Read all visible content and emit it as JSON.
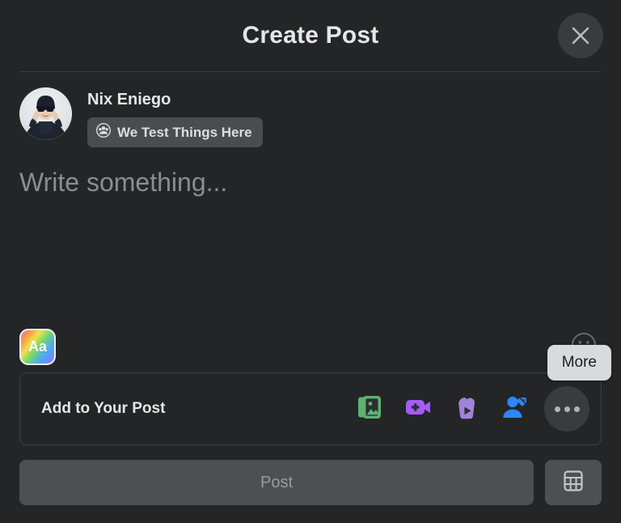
{
  "header": {
    "title": "Create Post",
    "close_icon": "close-icon"
  },
  "author": {
    "name": "Nix Eniego",
    "avatar_icon": "avatar-photo",
    "audience": {
      "label": "We Test Things Here",
      "icon": "friends-group-icon"
    }
  },
  "composer": {
    "placeholder": "Write something...",
    "value": "",
    "background_button": {
      "label": "Aa",
      "icon": "text-background-icon"
    },
    "emoji_button": {
      "icon": "smiley-face-icon"
    }
  },
  "add_section": {
    "label": "Add to Your Post",
    "actions": [
      {
        "name": "photo-video",
        "icon": "photo-video-icon",
        "color": "#5db274"
      },
      {
        "name": "live-video",
        "icon": "live-video-icon",
        "color": "#a45cf5"
      },
      {
        "name": "reels",
        "icon": "reels-icon",
        "color": "#a084d8"
      },
      {
        "name": "tag-people",
        "icon": "tag-people-icon",
        "color": "#2d86ff"
      }
    ],
    "more_button": {
      "icon": "ellipsis-icon",
      "tooltip": "More"
    }
  },
  "footer": {
    "post_label": "Post",
    "post_disabled": true,
    "grid_button_icon": "grid-view-icon"
  },
  "colors": {
    "background": "#242526",
    "surface": "#3a3b3c",
    "text_primary": "#e4e6eb",
    "text_secondary": "#8a8d91",
    "tooltip_bg": "#d8dadd"
  }
}
